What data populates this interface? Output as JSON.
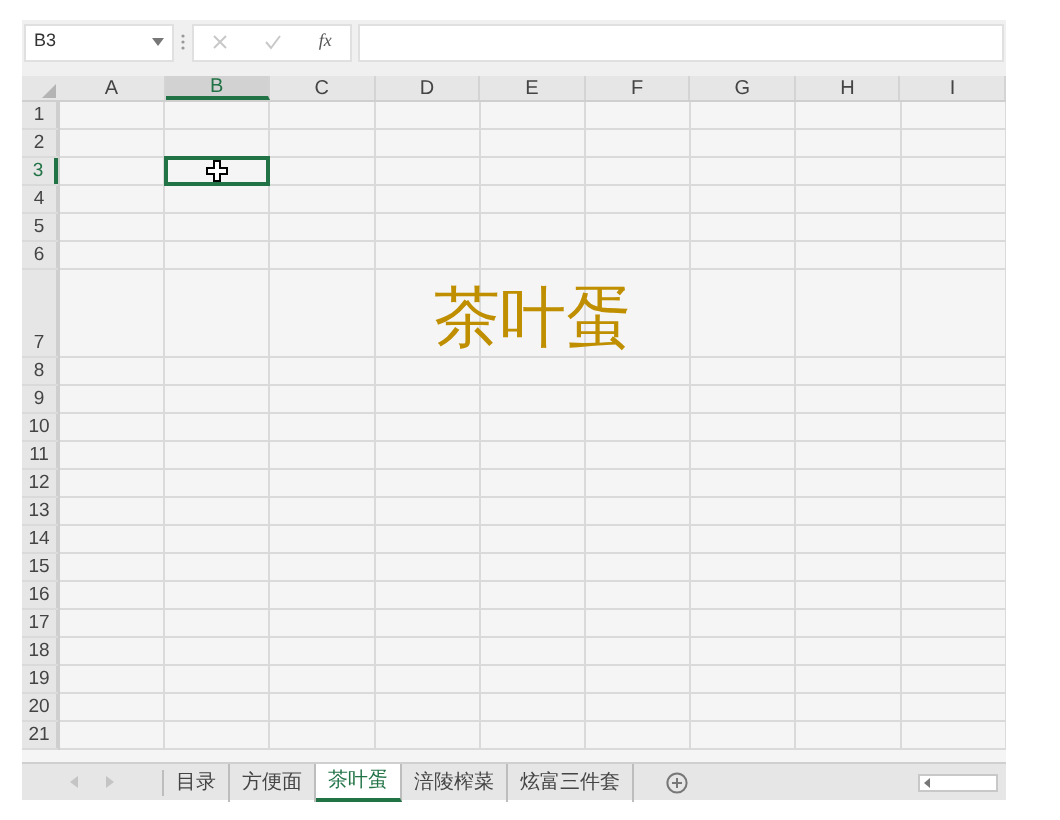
{
  "formula_bar": {
    "name_box": "B3",
    "function_label": "fx"
  },
  "columns": [
    {
      "label": "A",
      "selected": false
    },
    {
      "label": "B",
      "selected": true
    },
    {
      "label": "C",
      "selected": false
    },
    {
      "label": "D",
      "selected": false
    },
    {
      "label": "E",
      "selected": false
    },
    {
      "label": "F",
      "selected": false
    },
    {
      "label": "G",
      "selected": false
    },
    {
      "label": "H",
      "selected": false
    },
    {
      "label": "I",
      "selected": false
    }
  ],
  "rows": [
    {
      "label": "1",
      "selected": false
    },
    {
      "label": "2",
      "selected": false
    },
    {
      "label": "3",
      "selected": true
    },
    {
      "label": "4",
      "selected": false
    },
    {
      "label": "5",
      "selected": false
    },
    {
      "label": "6",
      "selected": false
    },
    {
      "label": "7",
      "selected": false,
      "text": "茶叶蛋"
    },
    {
      "label": "8",
      "selected": false
    },
    {
      "label": "9",
      "selected": false
    },
    {
      "label": "10",
      "selected": false
    },
    {
      "label": "11",
      "selected": false
    },
    {
      "label": "12",
      "selected": false
    },
    {
      "label": "13",
      "selected": false
    },
    {
      "label": "14",
      "selected": false
    },
    {
      "label": "15",
      "selected": false
    },
    {
      "label": "16",
      "selected": false
    },
    {
      "label": "17",
      "selected": false
    },
    {
      "label": "18",
      "selected": false
    },
    {
      "label": "19",
      "selected": false
    },
    {
      "label": "20",
      "selected": false
    },
    {
      "label": "21",
      "selected": false
    }
  ],
  "sheet_tabs": [
    {
      "label": "目录",
      "selected": false
    },
    {
      "label": "方便面",
      "selected": false
    },
    {
      "label": "茶叶蛋",
      "selected": true
    },
    {
      "label": "涪陵榨菜",
      "selected": false
    },
    {
      "label": "炫富三件套",
      "selected": false
    }
  ]
}
